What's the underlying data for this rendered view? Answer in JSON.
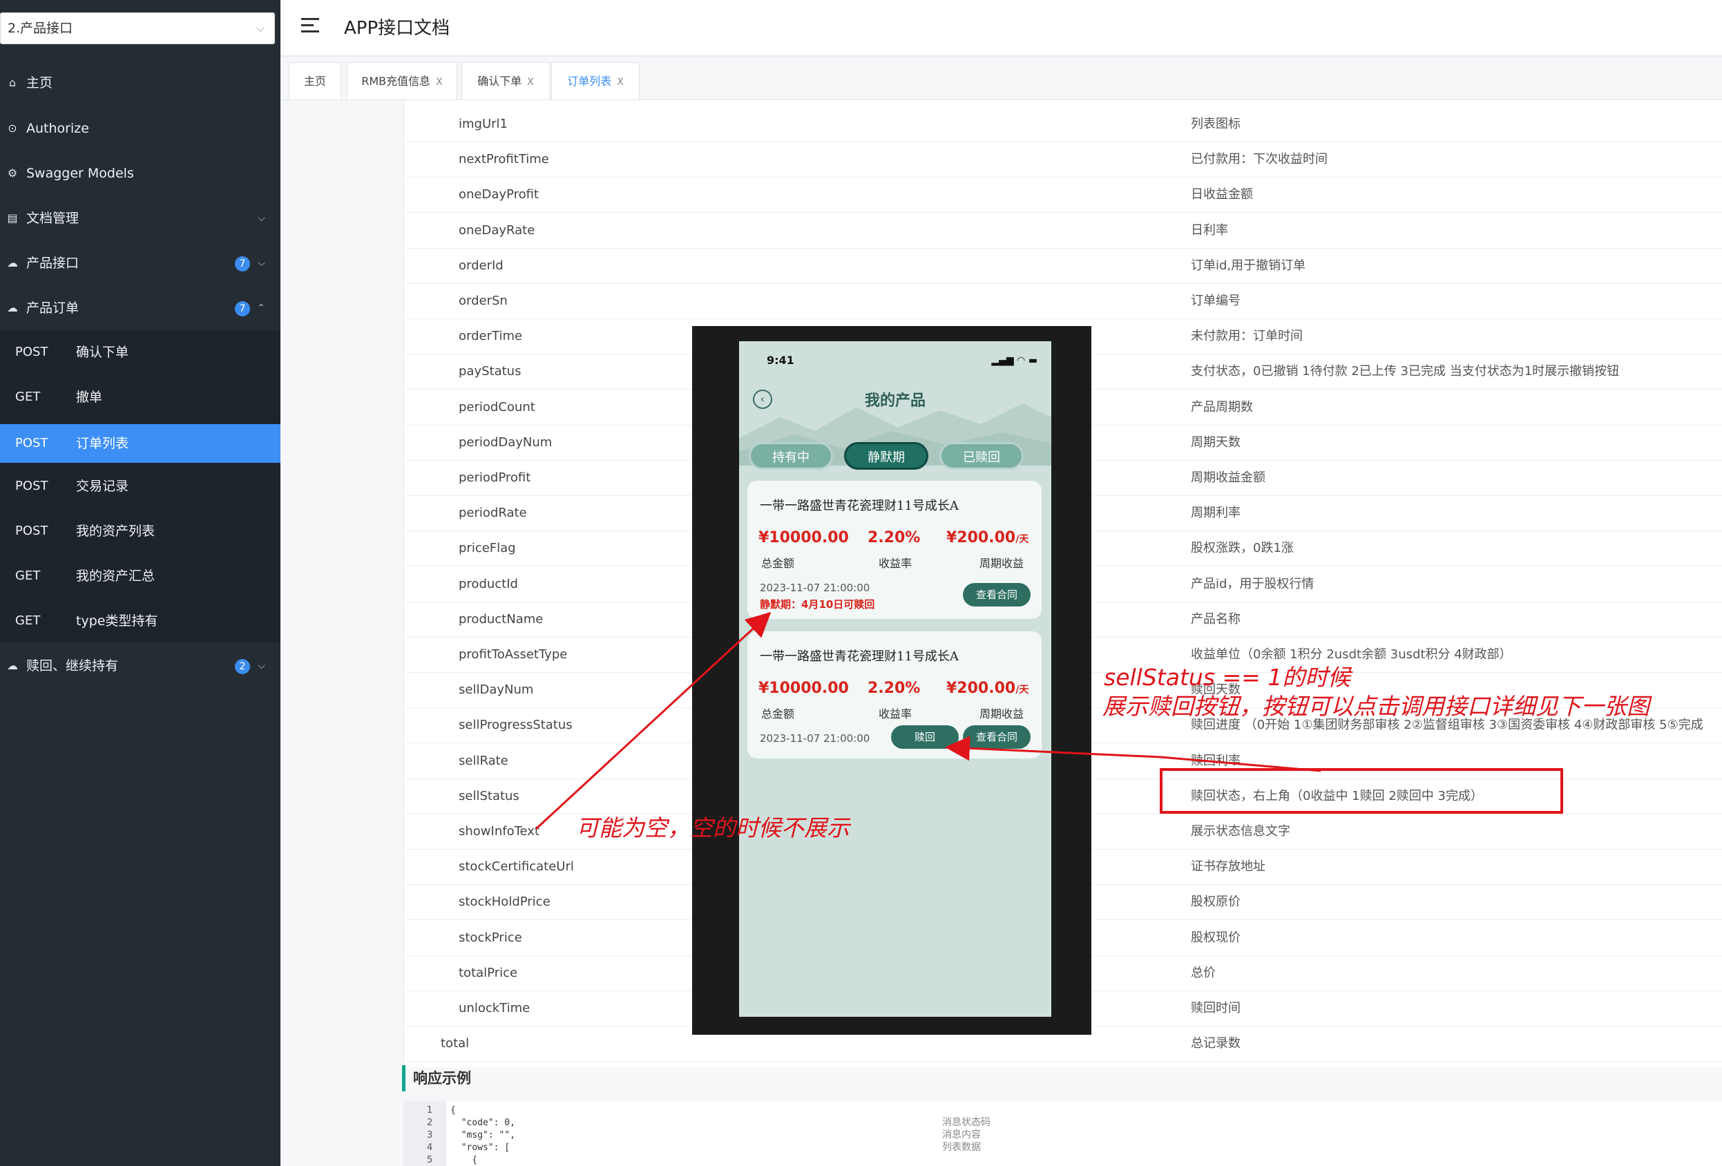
{
  "sidebar": {
    "group_select": "2.产品接口",
    "items": [
      {
        "label": "主页",
        "icon": "home-icon"
      },
      {
        "label": "Authorize",
        "icon": "lock-icon"
      },
      {
        "label": "Swagger Models",
        "icon": "gear-icon"
      },
      {
        "label": "文档管理",
        "icon": "doc-icon"
      },
      {
        "label": "产品接口",
        "icon": "cloud-icon",
        "badge": "7"
      },
      {
        "label": "产品订单",
        "icon": "cloud-icon",
        "badge": "7"
      },
      {
        "label": "赎回、继续持有",
        "icon": "cloud-icon",
        "badge": "2"
      }
    ],
    "sub_items": [
      {
        "method": "POST",
        "label": "确认下单"
      },
      {
        "method": "GET",
        "label": "撤单"
      },
      {
        "method": "POST",
        "label": "订单列表",
        "active": true
      },
      {
        "method": "POST",
        "label": "交易记录"
      },
      {
        "method": "POST",
        "label": "我的资产列表"
      },
      {
        "method": "GET",
        "label": "我的资产汇总"
      },
      {
        "method": "GET",
        "label": "type类型持有"
      }
    ]
  },
  "header": {
    "title": "APP接口文档"
  },
  "tabs": [
    "主页",
    "RMB充值信息",
    "确认下单",
    "订单列表"
  ],
  "tab_close": "X",
  "fields": [
    {
      "name": "imgUrl1",
      "desc": "列表图标"
    },
    {
      "name": "nextProfitTime",
      "desc": "已付款用：下次收益时间"
    },
    {
      "name": "oneDayProfit",
      "desc": "日收益金额"
    },
    {
      "name": "oneDayRate",
      "desc": "日利率"
    },
    {
      "name": "orderId",
      "desc": "订单id,用于撤销订单"
    },
    {
      "name": "orderSn",
      "desc": "订单编号"
    },
    {
      "name": "orderTime",
      "desc": "未付款用：订单时间"
    },
    {
      "name": "payStatus",
      "desc": "支付状态，0已撤销 1待付款 2已上传 3已完成 当支付状态为1时展示撤销按钮"
    },
    {
      "name": "periodCount",
      "desc": "产品周期数"
    },
    {
      "name": "periodDayNum",
      "desc": "周期天数"
    },
    {
      "name": "periodProfit",
      "desc": "周期收益金额"
    },
    {
      "name": "periodRate",
      "desc": "周期利率"
    },
    {
      "name": "priceFlag",
      "desc": "股权涨跌，0跌1涨"
    },
    {
      "name": "productId",
      "desc": "产品id，用于股权行情"
    },
    {
      "name": "productName",
      "desc": "产品名称"
    },
    {
      "name": "profitToAssetType",
      "desc": "收益单位（0余额 1积分 2usdt余额 3usdt积分 4财政部）"
    },
    {
      "name": "sellDayNum",
      "desc": "赎回天数"
    },
    {
      "name": "sellProgressStatus",
      "desc": "赎回进度 （0开始 1①集团财务部审核 2②监督组审核 3③国资委审核 4④财政部审核 5⑤完成"
    },
    {
      "name": "sellRate",
      "desc": "赎回利率"
    },
    {
      "name": "sellStatus",
      "desc": "赎回状态，右上角（0收益中 1赎回 2赎回中 3完成）"
    },
    {
      "name": "showInfoText",
      "desc": "展示状态信息文字"
    },
    {
      "name": "stockCertificateUrl",
      "desc": "证书存放地址"
    },
    {
      "name": "stockHoldPrice",
      "desc": "股权原价"
    },
    {
      "name": "stockPrice",
      "desc": "股权现价"
    },
    {
      "name": "totalPrice",
      "desc": "总价"
    },
    {
      "name": "unlockTime",
      "desc": "赎回时间"
    },
    {
      "name": "total",
      "desc": "总记录数"
    }
  ],
  "response": {
    "title": "响应示例",
    "gutter": [
      "1",
      "2",
      "3",
      "4",
      "5"
    ],
    "lines": [
      "{",
      "  \"code\": 0,",
      "  \"msg\": \"\",",
      "  \"rows\": [",
      "    {"
    ],
    "comments": [
      "消息状态码",
      "消息内容",
      "列表数据"
    ]
  },
  "phone": {
    "time": "9:41",
    "status_icons": "▂▄▆ ◠ ▬",
    "back": "‹",
    "title": "我的产品",
    "tabs": [
      "持有中",
      "静默期",
      "已赎回"
    ],
    "cards": [
      {
        "name": "一带一路盛世青花瓷理财11号成长A",
        "amount": "¥10000.00",
        "rate": "2.20%",
        "period_profit": "¥200.00",
        "unit": "/天",
        "amount_label": "总金额",
        "rate_label": "收益率",
        "period_label": "周期收益",
        "datetime": "2023-11-07 21:00:00",
        "status_text": "静默期：4月10日可赎回",
        "contract_btn": "查看合同"
      },
      {
        "name": "一带一路盛世青花瓷理财11号成长A",
        "amount": "¥10000.00",
        "rate": "2.20%",
        "period_profit": "¥200.00",
        "unit": "/天",
        "amount_label": "总金额",
        "rate_label": "收益率",
        "period_label": "周期收益",
        "datetime": "2023-11-07 21:00:00",
        "redeem_btn": "赎回",
        "contract_btn": "查看合同"
      }
    ]
  },
  "annotations": {
    "sell_status_line1": "sellStatus == 1的时候",
    "sell_status_line2": "展示赎回按钮，按钮可以点击调用接口详细见下一张图",
    "show_info": "可能为空，空的时候不展示"
  },
  "colors": {
    "sidebar": "#242c34",
    "active": "#3d8ff6",
    "annotation": "#e0141a",
    "phone_accent": "#2e6f62"
  }
}
